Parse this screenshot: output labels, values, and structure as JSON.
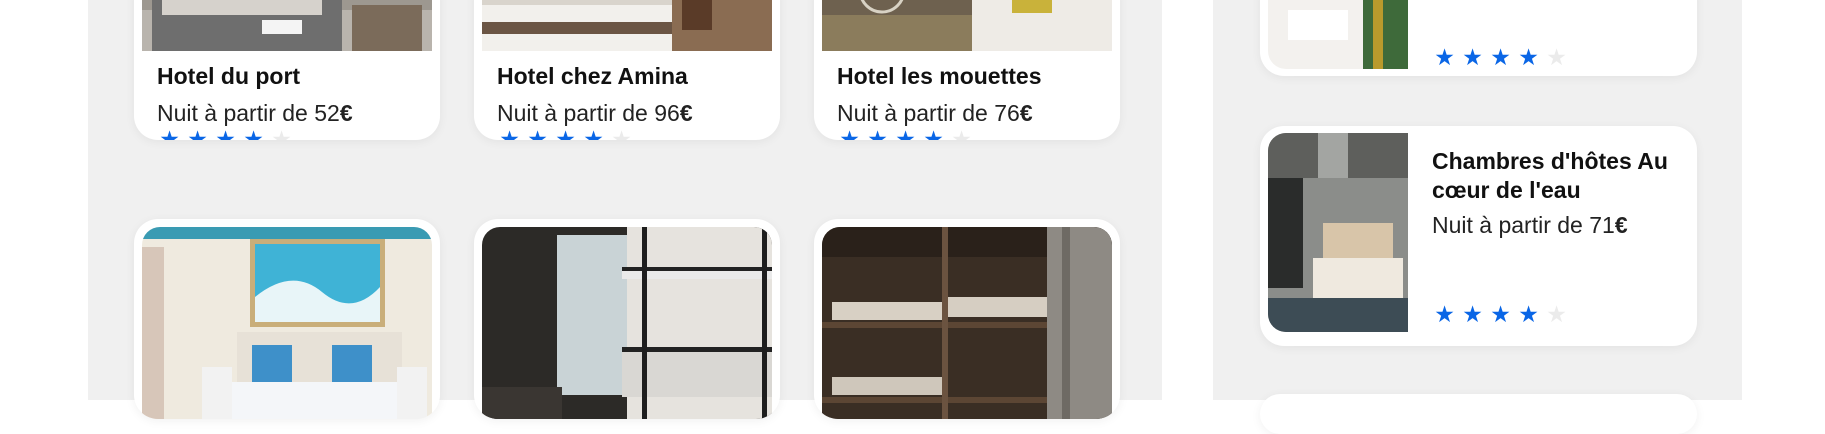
{
  "currency_symbol": "€",
  "price_prefix": "Nuit à partir de ",
  "colors": {
    "star_on": "#0a66e6",
    "star_off": "#ebebeb",
    "panel_bg": "#f0f0f0"
  },
  "grid": {
    "top_row": [
      {
        "name": "Hotel du port",
        "price": "52",
        "rating": 4
      },
      {
        "name": "Hotel chez Amina",
        "price": "96",
        "rating": 4
      },
      {
        "name": "Hotel les mouettes",
        "price": "76",
        "rating": 4
      }
    ],
    "bottom_row": [
      {
        "photo": "seaside-bedroom"
      },
      {
        "photo": "bunk-bed-room"
      },
      {
        "photo": "wooden-dorm"
      }
    ]
  },
  "side_list": [
    {
      "name": "",
      "price": "",
      "rating": 4
    },
    {
      "name": "Chambres d'hôtes Au cœur de l'eau",
      "price": "71",
      "rating": 4
    }
  ]
}
